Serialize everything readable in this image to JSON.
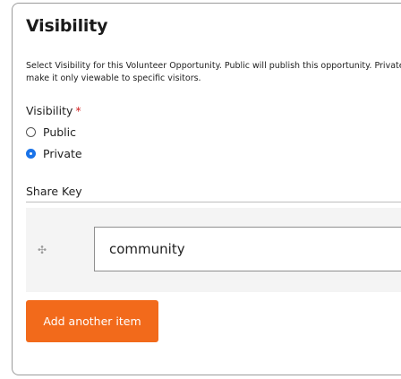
{
  "section": {
    "title": "Visibility",
    "description": "Select Visibility for this Volunteer Opportunity. Public will publish this opportunity. Private will make it only viewable to specific visitors."
  },
  "visibility": {
    "label": "Visibility",
    "required_marker": "*",
    "options": [
      {
        "label": "Public",
        "checked": false
      },
      {
        "label": "Private",
        "checked": true
      }
    ]
  },
  "share_key": {
    "label": "Share Key",
    "drag_icon": "drag-handle-icon",
    "items": [
      {
        "value": "community"
      }
    ]
  },
  "actions": {
    "add_item_label": "Add another item",
    "button_color": "#f26a1b"
  }
}
